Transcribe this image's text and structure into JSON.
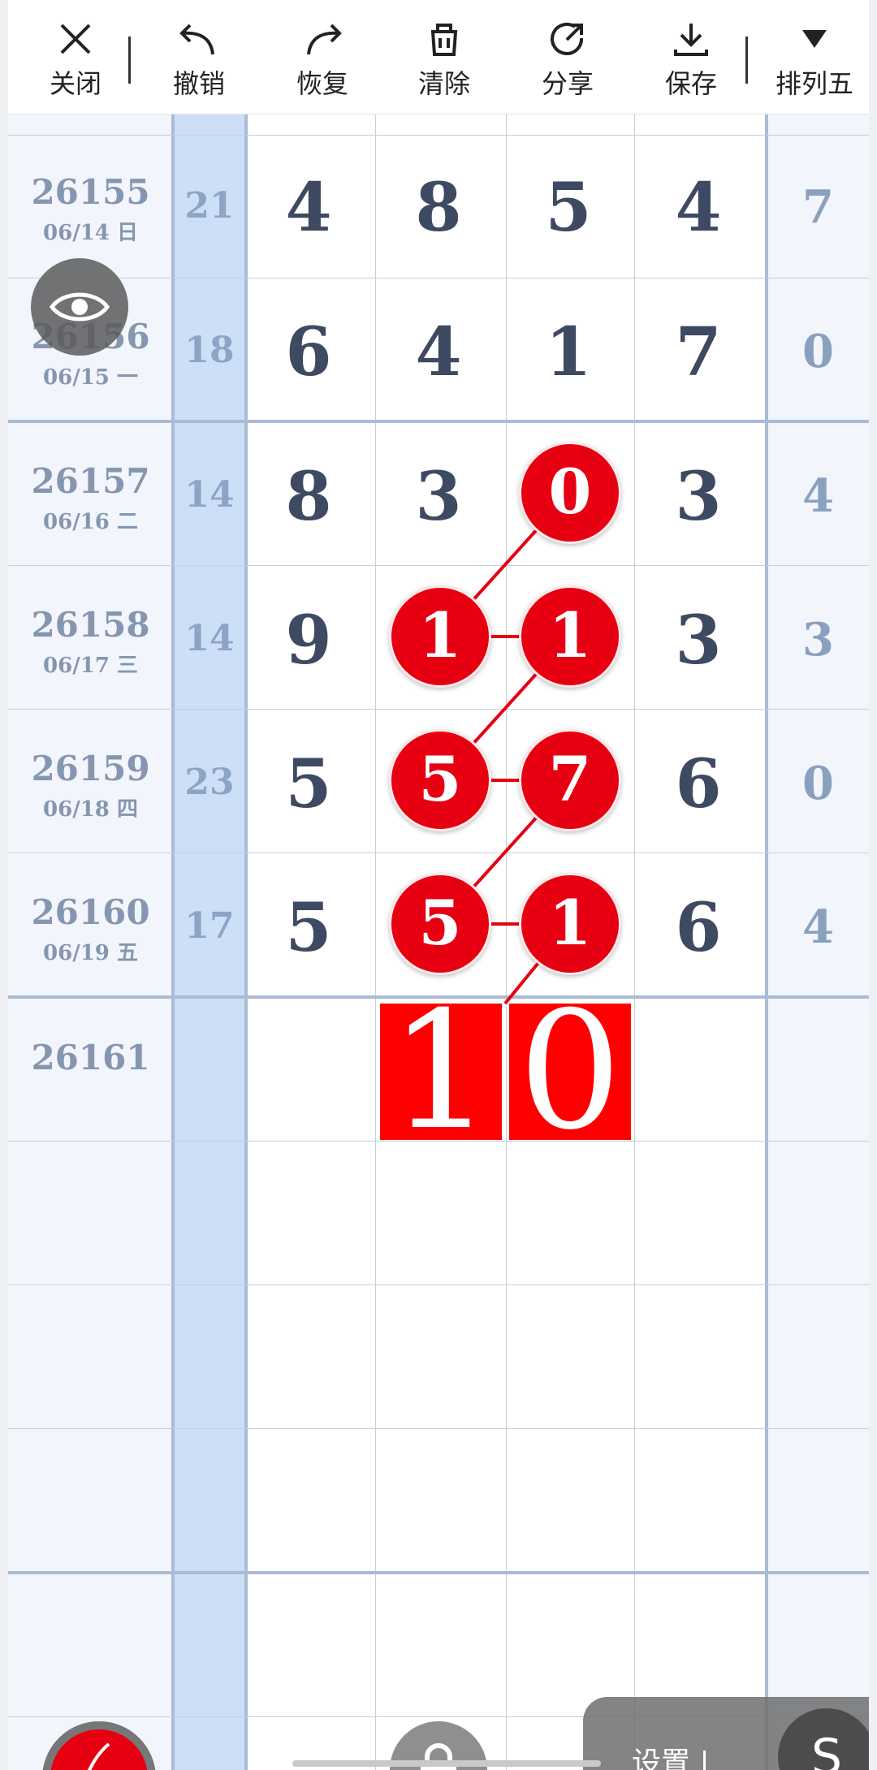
{
  "toolbar": {
    "close": "关闭",
    "undo": "撤销",
    "redo": "恢复",
    "clear": "清除",
    "share": "分享",
    "save": "保存",
    "lottery": "排列五"
  },
  "rows": [
    {
      "issue": "26155",
      "date": "06/14 日",
      "sum": "21",
      "d1": "4",
      "d2": "8",
      "d3": "5",
      "d4": "4",
      "d5": "7"
    },
    {
      "issue": "26156",
      "date": "06/15 一",
      "sum": "18",
      "d1": "6",
      "d2": "4",
      "d3": "1",
      "d4": "7",
      "d5": "0"
    },
    {
      "issue": "26157",
      "date": "06/16 二",
      "sum": "14",
      "d1": "8",
      "d2": "3",
      "d3": "0",
      "d4": "3",
      "d5": "4"
    },
    {
      "issue": "26158",
      "date": "06/17 三",
      "sum": "14",
      "d1": "9",
      "d2": "1",
      "d3": "1",
      "d4": "3",
      "d5": "3"
    },
    {
      "issue": "26159",
      "date": "06/18 四",
      "sum": "23",
      "d1": "5",
      "d2": "5",
      "d3": "7",
      "d4": "6",
      "d5": "0"
    },
    {
      "issue": "26160",
      "date": "06/19 五",
      "sum": "17",
      "d1": "5",
      "d2": "5",
      "d3": "1",
      "d4": "6",
      "d5": "4"
    }
  ],
  "next_issue": "26161",
  "prediction": {
    "d2": "1",
    "d3": "0"
  },
  "settings": {
    "label": "设置",
    "s_button": "S"
  },
  "colors": {
    "ball": "#e60012",
    "digit": "#3d4a61",
    "sum_column": "#cddff6"
  }
}
